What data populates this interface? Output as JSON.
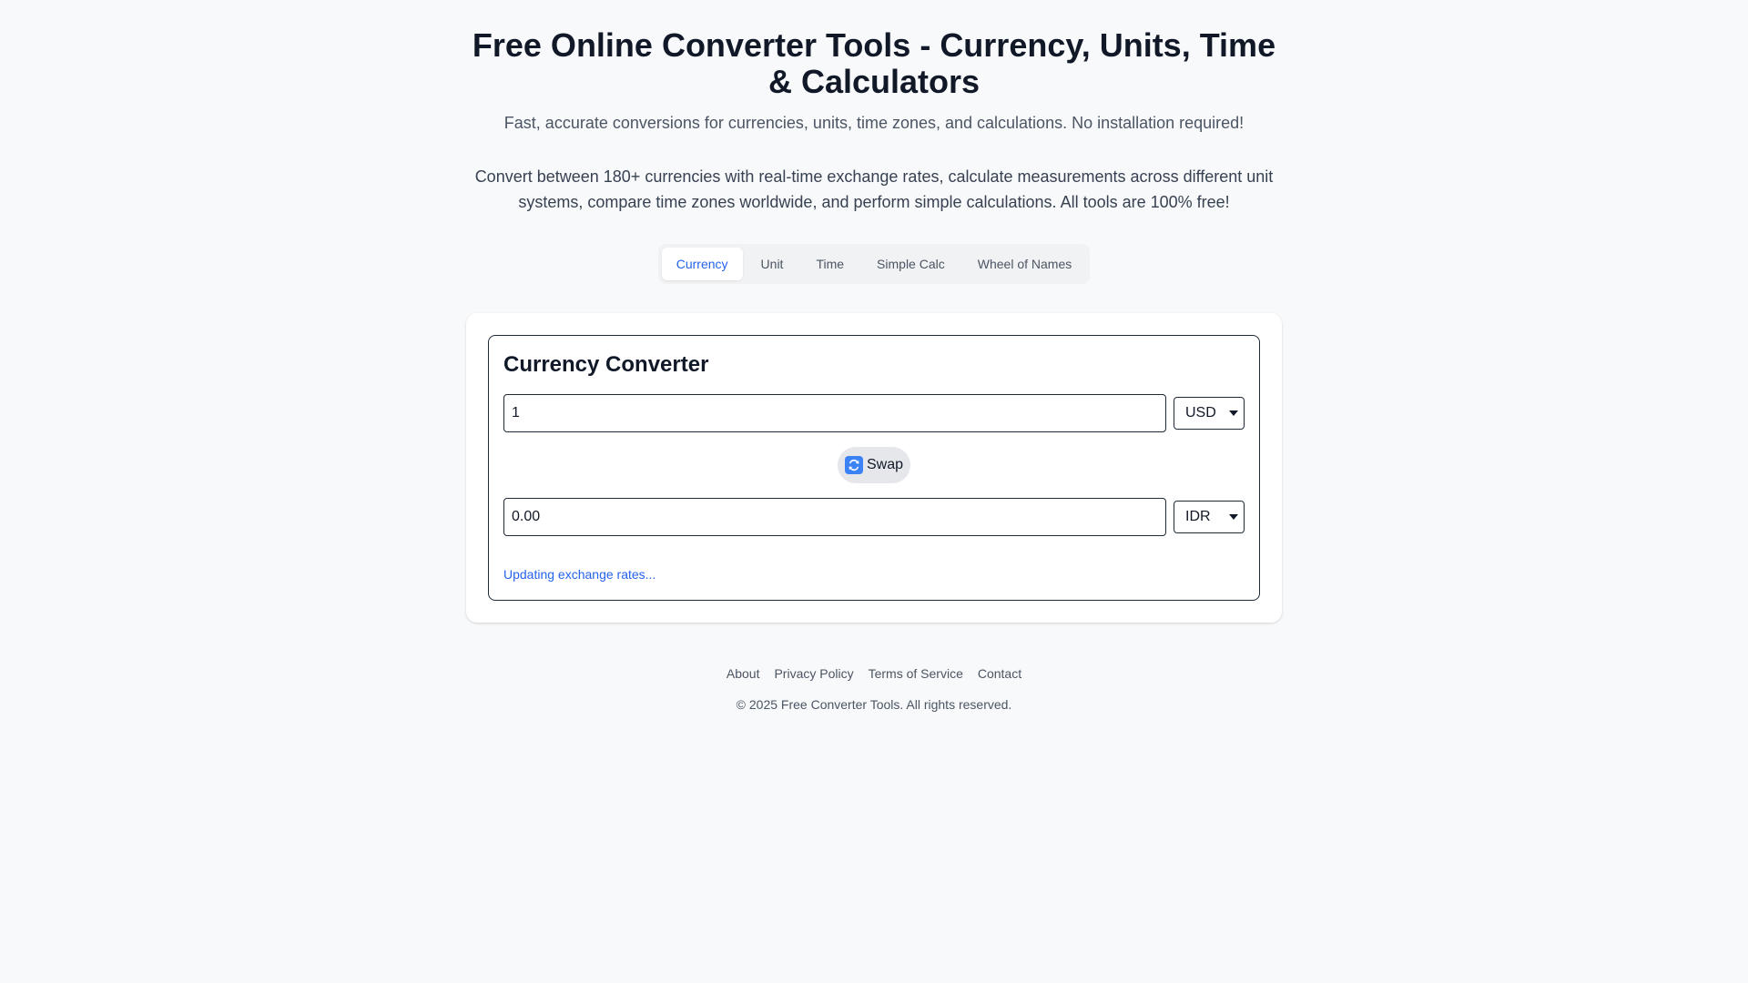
{
  "header": {
    "title": "Free Online Converter Tools - Currency, Units, Time & Calculators",
    "subtitle": "Fast, accurate conversions for currencies, units, time zones, and calculations. No installation required!",
    "description": "Convert between 180+ currencies with real-time exchange rates, calculate measurements across different unit systems, compare time zones worldwide, and perform simple calculations. All tools are 100% free!"
  },
  "tabs": [
    {
      "label": "Currency",
      "active": true
    },
    {
      "label": "Unit",
      "active": false
    },
    {
      "label": "Time",
      "active": false
    },
    {
      "label": "Simple Calc",
      "active": false
    },
    {
      "label": "Wheel of Names",
      "active": false
    }
  ],
  "converter": {
    "title": "Currency Converter",
    "from_amount": "1",
    "from_currency": "USD",
    "swap_label": "Swap",
    "to_amount": "0.00",
    "to_currency": "IDR",
    "status": "Updating exchange rates..."
  },
  "footer": {
    "links": [
      "About",
      "Privacy Policy",
      "Terms of Service",
      "Contact"
    ],
    "copyright": "© 2025 Free Converter Tools. All rights reserved."
  },
  "colors": {
    "accent": "#2563eb",
    "background": "#f8f9fb",
    "swap_icon": "#3b82f6"
  },
  "icons": {
    "swap": "swap-arrows-icon",
    "dropdown": "chevron-down-icon"
  }
}
